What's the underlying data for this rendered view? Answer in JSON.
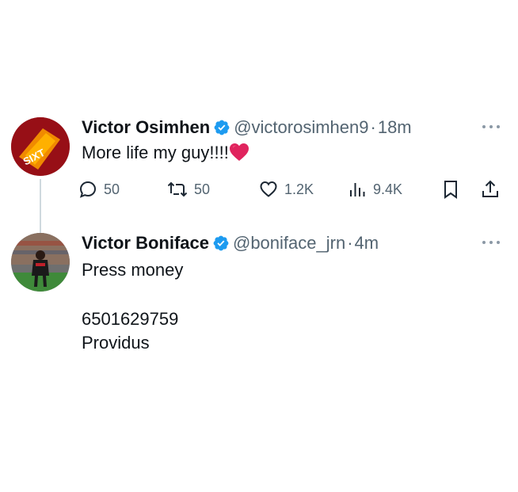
{
  "thread": [
    {
      "author_name": "Victor Osimhen",
      "handle": "@victorosimhen9",
      "separator": "·",
      "time": "18m",
      "text": "More life my guy!!!!",
      "emoji": "heart-emoji",
      "stats": {
        "replies": "50",
        "retweets": "50",
        "likes": "1.2K",
        "views": "9.4K"
      },
      "avatar_label": "SIXT"
    },
    {
      "author_name": "Victor Boniface",
      "handle": "@boniface_jrn",
      "separator": "·",
      "time": "4m",
      "text_lines": [
        "Press money",
        "6501629759",
        "Providus"
      ]
    }
  ],
  "icons": {
    "verified": "verified-badge-icon",
    "more": "more-options-icon",
    "reply": "reply-icon",
    "retweet": "retweet-icon",
    "like": "like-icon",
    "views": "views-icon",
    "bookmark": "bookmark-icon",
    "share": "share-icon"
  },
  "colors": {
    "text": "#0f1419",
    "secondary": "#536471",
    "verified_blue": "#1d9bf0",
    "heart_red": "#e0245e",
    "thread_line": "#cfd9de"
  }
}
